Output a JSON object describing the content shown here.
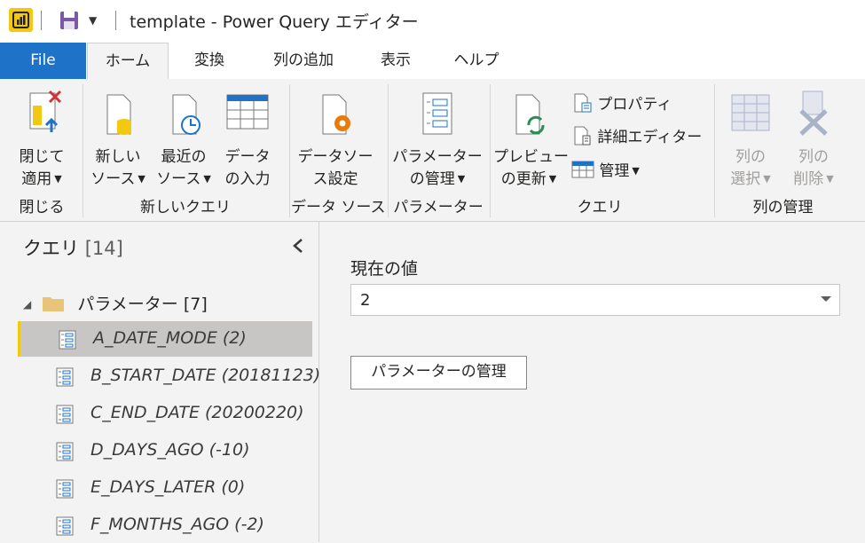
{
  "window": {
    "title": "template - Power Query エディター"
  },
  "tabs": [
    {
      "label": "File"
    },
    {
      "label": "ホーム"
    },
    {
      "label": "変換"
    },
    {
      "label": "列の追加"
    },
    {
      "label": "表示"
    },
    {
      "label": "ヘルプ"
    }
  ],
  "ribbon": {
    "close_apply": {
      "line1": "閉じて",
      "line2": "適用"
    },
    "new_source": {
      "line1": "新しい",
      "line2": "ソース"
    },
    "recent_source": {
      "line1": "最近の",
      "line2": "ソース"
    },
    "enter_data": {
      "line1": "データ",
      "line2": "の入力"
    },
    "datasource_settings": {
      "line1": "データソー",
      "line2": "ス設定"
    },
    "manage_params": {
      "line1": "パラメーター",
      "line2": "の管理"
    },
    "refresh_preview": {
      "line1": "プレビュー",
      "line2": "の更新"
    },
    "properties": "プロパティ",
    "advanced_editor": "詳細エディター",
    "manage": "管理",
    "choose_columns": {
      "line1": "列の",
      "line2": "選択"
    },
    "remove_columns": {
      "line1": "列の",
      "line2": "削除"
    },
    "groups": {
      "close": "閉じる",
      "new_query": "新しいクエリ",
      "datasource": "データ ソース",
      "parameters": "パラメーター",
      "query": "クエリ",
      "manage_columns": "列の管理"
    }
  },
  "queries": {
    "title": "クエリ",
    "count": "[14]",
    "folder": {
      "name": "パラメーター",
      "count": "[7]"
    },
    "items": [
      {
        "label": "A_DATE_MODE (2)"
      },
      {
        "label": "B_START_DATE (20181123)"
      },
      {
        "label": "C_END_DATE (20200220)"
      },
      {
        "label": "D_DAYS_AGO (-10)"
      },
      {
        "label": "E_DAYS_LATER (0)"
      },
      {
        "label": "F_MONTHS_AGO (-2)"
      }
    ]
  },
  "main": {
    "current_value_label": "現在の値",
    "current_value": "2",
    "manage_button": "パラメーターの管理"
  }
}
